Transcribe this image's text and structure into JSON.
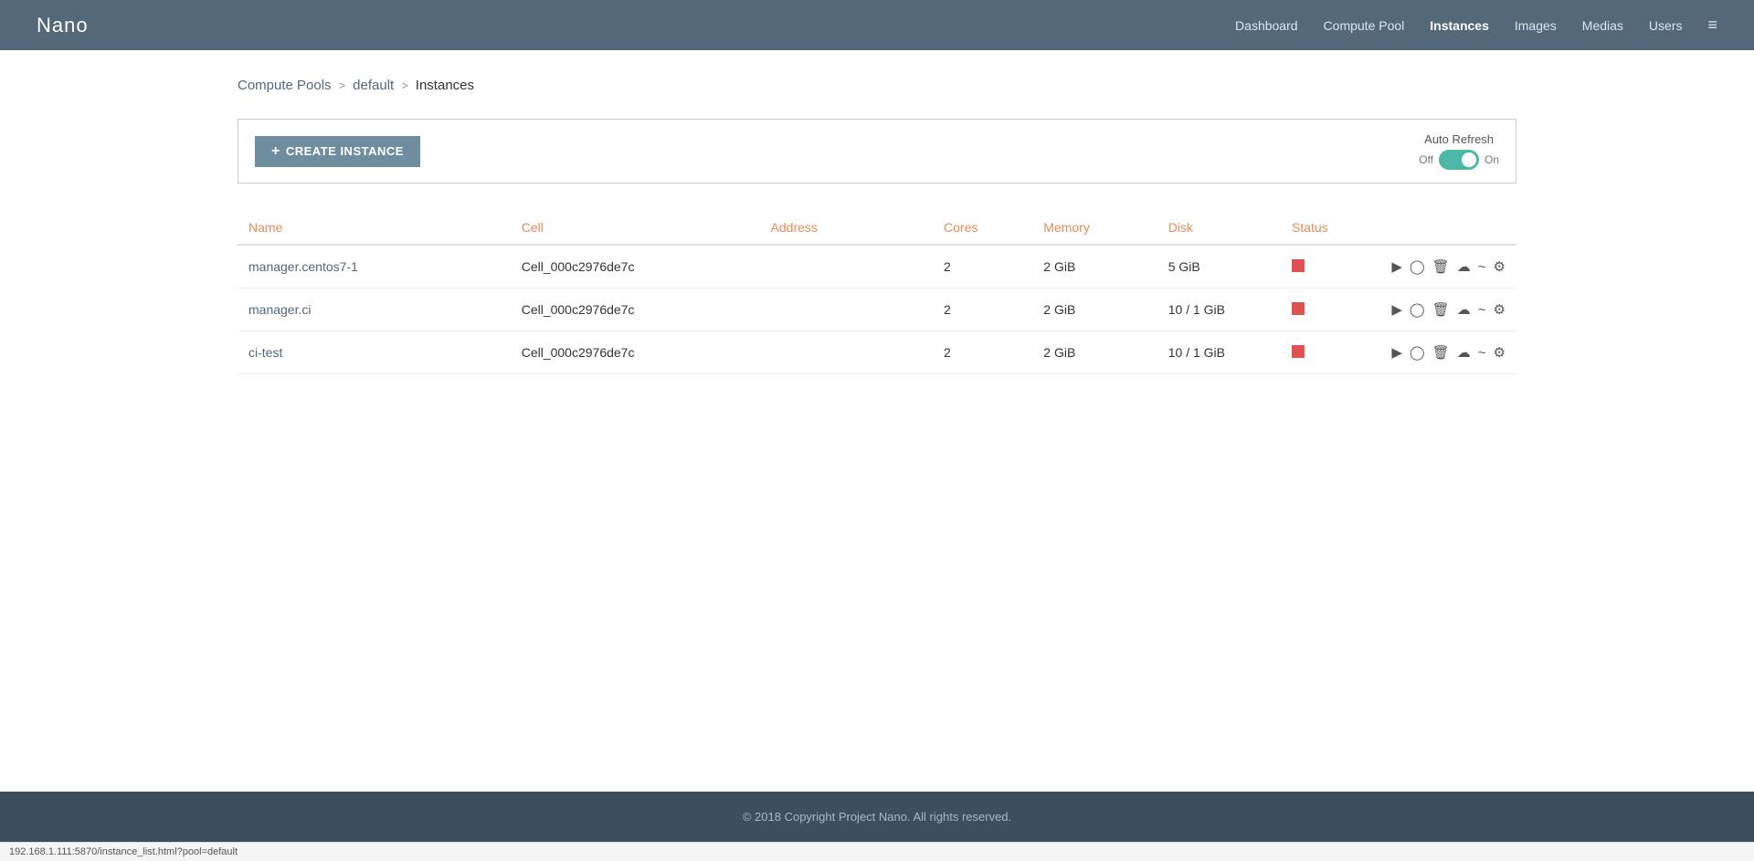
{
  "header": {
    "logo": "Nano",
    "nav": [
      {
        "label": "Dashboard",
        "active": false
      },
      {
        "label": "Compute Pool",
        "active": false
      },
      {
        "label": "Instances",
        "active": true
      },
      {
        "label": "Images",
        "active": false
      },
      {
        "label": "Medias",
        "active": false
      },
      {
        "label": "Users",
        "active": false
      }
    ],
    "menu_icon": "≡"
  },
  "breadcrumb": {
    "pools": "Compute Pools",
    "sep1": ">",
    "pool_name": "default",
    "sep2": ">",
    "current": "Instances"
  },
  "toolbar": {
    "create_label": "CREATE INSTANCE",
    "create_plus": "+",
    "auto_refresh_label": "Auto Refresh",
    "toggle_off": "Off",
    "toggle_on": "On"
  },
  "table": {
    "columns": [
      "Name",
      "Cell",
      "Address",
      "Cores",
      "Memory",
      "Disk",
      "Status"
    ],
    "rows": [
      {
        "name": "manager.centos7-1",
        "cell": "Cell_000c2976de7c",
        "address": "",
        "cores": "2",
        "memory": "2 GiB",
        "disk": "5 GiB",
        "status": "stopped"
      },
      {
        "name": "manager.ci",
        "cell": "Cell_000c2976de7c",
        "address": "",
        "cores": "2",
        "memory": "2 GiB",
        "disk": "10 / 1 GiB",
        "status": "stopped"
      },
      {
        "name": "ci-test",
        "cell": "Cell_000c2976de7c",
        "address": "",
        "cores": "2",
        "memory": "2 GiB",
        "disk": "10 / 1 GiB",
        "status": "stopped"
      }
    ]
  },
  "footer": {
    "copyright": "© 2018 Copyright Project Nano. All rights reserved."
  },
  "statusbar": {
    "url": "192.168.1.111:5870/instance_list.html?pool=default"
  },
  "colors": {
    "accent": "#e08c5a",
    "header_bg": "#536878",
    "status_red": "#e05252",
    "toggle_on": "#4db8a8"
  }
}
